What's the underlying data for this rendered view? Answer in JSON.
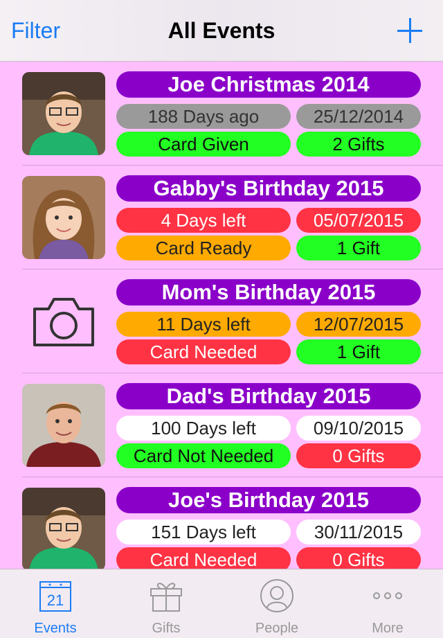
{
  "nav": {
    "filter_label": "Filter",
    "title": "All Events",
    "add_icon": "plus-icon"
  },
  "colors": {
    "accent": "#1a7cf5",
    "background": "#ffbfff",
    "title_pill": "#8b00c9",
    "grey": "#9a9a9a",
    "green": "#22ff22",
    "red": "#ff3344",
    "orange": "#ffaa00",
    "white": "#ffffff"
  },
  "events": [
    {
      "title": "Joe Christmas 2014",
      "photo": "photo-boy",
      "days": "188 Days ago",
      "days_color": "grey",
      "date": "25/12/2014",
      "date_color": "grey",
      "card": "Card Given",
      "card_color": "green",
      "gifts": "2 Gifts",
      "gifts_color": "green"
    },
    {
      "title": "Gabby's Birthday 2015",
      "photo": "photo-girl",
      "days": "4 Days left",
      "days_color": "red",
      "date": "05/07/2015",
      "date_color": "red",
      "card": "Card Ready",
      "card_color": "orange",
      "gifts": "1 Gift",
      "gifts_color": "green"
    },
    {
      "title": "Mom's Birthday 2015",
      "photo": "camera-icon",
      "days": "11 Days left",
      "days_color": "orange",
      "date": "12/07/2015",
      "date_color": "orange",
      "card": "Card Needed",
      "card_color": "red",
      "gifts": "1 Gift",
      "gifts_color": "green"
    },
    {
      "title": "Dad's Birthday 2015",
      "photo": "photo-man",
      "days": "100 Days left",
      "days_color": "white",
      "date": "09/10/2015",
      "date_color": "white",
      "card": "Card Not Needed",
      "card_color": "green",
      "gifts": "0 Gifts",
      "gifts_color": "red"
    },
    {
      "title": "Joe's Birthday 2015",
      "photo": "photo-boy",
      "days": "151 Days left",
      "days_color": "white",
      "date": "30/11/2015",
      "date_color": "white",
      "card": "Card Needed",
      "card_color": "red",
      "gifts": "0 Gifts",
      "gifts_color": "red"
    }
  ],
  "tabs": [
    {
      "label": "Events",
      "icon": "calendar-icon",
      "icon_text": "21",
      "active": true
    },
    {
      "label": "Gifts",
      "icon": "gift-icon",
      "active": false
    },
    {
      "label": "People",
      "icon": "person-icon",
      "active": false
    },
    {
      "label": "More",
      "icon": "more-icon",
      "active": false
    }
  ]
}
